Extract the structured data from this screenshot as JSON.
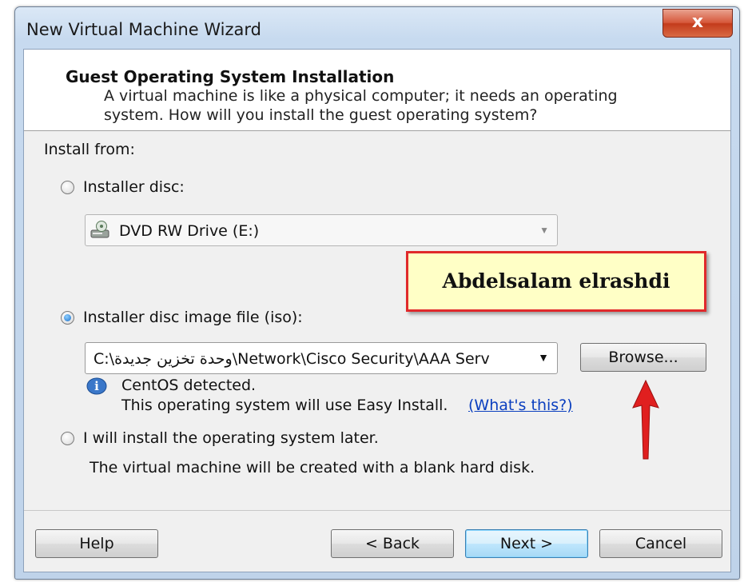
{
  "window": {
    "title": "New Virtual Machine Wizard",
    "close_label": "x"
  },
  "header": {
    "title": "Guest Operating System Installation",
    "description": "A virtual machine is like a physical computer; it needs an operating system. How will you install the guest operating system?"
  },
  "install_from_label": "Install from:",
  "options": {
    "disc": {
      "label": "Installer disc:",
      "selected": false,
      "drive_value": "DVD RW Drive (E:)"
    },
    "iso": {
      "label": "Installer disc image file (iso):",
      "selected": true,
      "path_value": "C:\\وحدة تخزين جديدة\\Network\\Cisco Security\\AAA Serv",
      "browse_label": "Browse...",
      "detected_title": "CentOS detected.",
      "detected_note": "This operating system will use Easy Install.",
      "whats_this_link": "(What's this?)"
    },
    "later": {
      "label": "I will install the operating system later.",
      "selected": false,
      "note": "The virtual machine will be created with a blank hard disk."
    }
  },
  "watermark_text": "Abdelsalam elrashdi",
  "footer": {
    "help_label": "Help",
    "back_label": "< Back",
    "next_label": "Next >",
    "cancel_label": "Cancel"
  },
  "colors": {
    "annotation_arrow": "#e01f1f",
    "link": "#0b3fbf"
  },
  "icons": [
    "close-icon",
    "dvd-drive-icon",
    "info-icon",
    "chevron-down-icon",
    "red-arrow-icon"
  ]
}
